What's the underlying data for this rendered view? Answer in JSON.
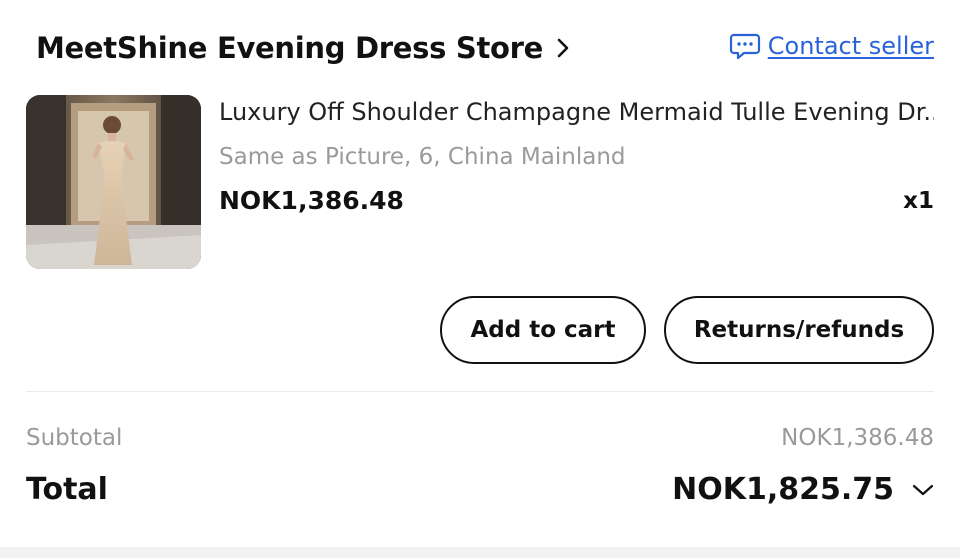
{
  "store": {
    "name": "MeetShine Evening Dress Store",
    "chevron_icon": "chevron-right-icon",
    "contact_label": "Contact seller",
    "contact_icon": "chat-bubble-icon",
    "link_color": "#2a63d8"
  },
  "product": {
    "image_icon": "product-photo",
    "title": "Luxury Off Shoulder Champagne Mermaid Tulle Evening Dr...",
    "variant": "Same as Picture, 6, China Mainland",
    "price": "NOK1,386.48",
    "quantity": "x1"
  },
  "actions": {
    "add_to_cart": "Add to cart",
    "returns": "Returns/refunds"
  },
  "summary": {
    "subtotal_label": "Subtotal",
    "subtotal_value": "NOK1,386.48",
    "total_label": "Total",
    "total_value": "NOK1,825.75",
    "expand_icon": "chevron-down-icon"
  }
}
